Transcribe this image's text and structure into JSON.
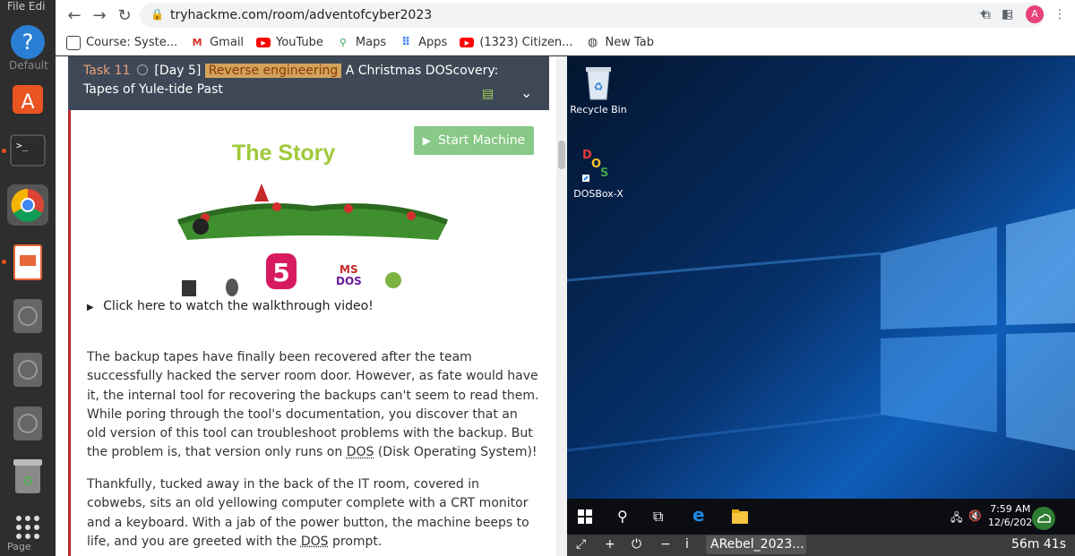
{
  "os": {
    "menu_stub": "File  Edi",
    "default_stub": "Default",
    "page_stub": "Page"
  },
  "browser": {
    "url": "tryhackme.com/room/adventofcyber2023",
    "avatar_letter": "A",
    "bookmarks": [
      {
        "label": "Course: Syste...",
        "icon": "course-icon"
      },
      {
        "label": "Gmail",
        "icon": "gmail-icon"
      },
      {
        "label": "YouTube",
        "icon": "youtube-icon"
      },
      {
        "label": "Maps",
        "icon": "maps-icon"
      },
      {
        "label": "Apps",
        "icon": "apps-icon"
      },
      {
        "label": "(1323) Citizen...",
        "icon": "youtube-icon"
      },
      {
        "label": "New Tab",
        "icon": "globe-icon"
      }
    ]
  },
  "task": {
    "number": "Task 11",
    "day": "[Day 5]",
    "tag": "Reverse engineering",
    "title_rest": "A Christmas DOScovery: Tapes of Yule-tide Past",
    "start_button": "Start Machine",
    "story_title": "The Story",
    "banner_number": "5",
    "banner_ms": "MS",
    "banner_dos": "DOS",
    "walkthrough": "Click here to watch the walkthrough video!",
    "para1_a": "The backup tapes have finally been recovered after the team successfully hacked the server room door. However, as fate would have it, the internal tool for recovering the backups can't seem to read them. While poring through the tool's documentation, you discover that an old version of this tool can troubleshoot problems with the backup. But the problem is, that version only runs on ",
    "para1_dos": "DOS",
    "para1_b": " (Disk Operating System)!",
    "para2_a": "Thankfully, tucked away in the back of the IT room, covered in cobwebs, sits an old yellowing computer complete with a CRT monitor and a keyboard. With a jab of the power button, the machine beeps to life, and you are greeted with the ",
    "para2_dos": "DOS",
    "para2_b": " prompt."
  },
  "desktop": {
    "icons": [
      {
        "label": "Recycle Bin",
        "icon": "recycle-bin-icon"
      },
      {
        "label": "DOSBox-X",
        "icon": "dosbox-icon"
      }
    ],
    "time": "7:59 AM",
    "date": "12/6/202"
  },
  "machine_bar": {
    "name": "ARebel_2023...",
    "timer": "56m 41s"
  }
}
